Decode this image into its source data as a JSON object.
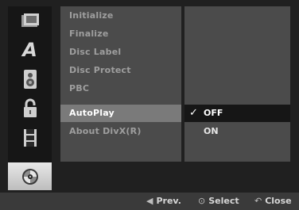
{
  "icons": [
    {
      "name": "disc-icon"
    },
    {
      "name": "language-icon",
      "glyph": "A"
    },
    {
      "name": "speaker-icon"
    },
    {
      "name": "lock-icon"
    },
    {
      "name": "film-icon"
    },
    {
      "name": "disc-settings-icon"
    }
  ],
  "menu": {
    "items": [
      {
        "label": "Initialize"
      },
      {
        "label": "Finalize"
      },
      {
        "label": "Disc Label"
      },
      {
        "label": "Disc Protect"
      },
      {
        "label": "PBC"
      },
      {
        "label": "AutoPlay"
      },
      {
        "label": "About DivX(R)"
      }
    ],
    "selected": "AutoPlay"
  },
  "options": {
    "items": [
      {
        "label": "OFF",
        "checked": true
      },
      {
        "label": "ON",
        "checked": false
      }
    ]
  },
  "bottom_bar": {
    "prev_label": "Prev.",
    "prev_symbol": "◀",
    "select_label": "Select",
    "select_symbol": "⊙",
    "close_label": "Close",
    "close_symbol": "↶"
  }
}
